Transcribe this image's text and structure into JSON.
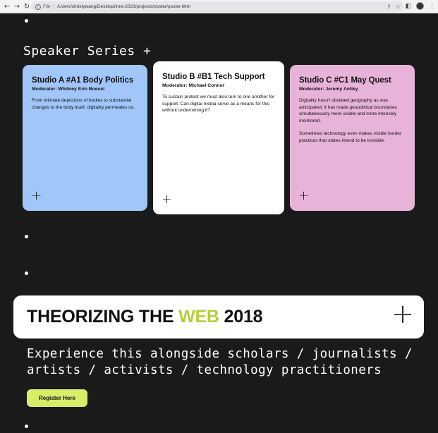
{
  "browser": {
    "back": "←",
    "forward": "→",
    "reload": "↻",
    "scheme": "File",
    "sep": "|",
    "url": "/Users/christywang/Desktop/imw-2023/projects/poster/poster.html",
    "share": "⇪",
    "star": "☆",
    "sidepanel": "◧",
    "menu": "⋮"
  },
  "series": {
    "title": "Speaker Series +"
  },
  "cards": [
    {
      "title": "Studio A #A1 Body Politics",
      "moderator": "Moderator: Whitney Erin Boesel",
      "paragraphs": [
        "From intimate depictions of bodies to substantial changes to the body itself, digitality permeates us."
      ],
      "plus": "+",
      "color": "#a0c6fa"
    },
    {
      "title": "Studio B #B1 Tech Support",
      "moderator": "Moderator: Michael Connor",
      "paragraphs": [
        "To sustain protest we must also turn to one another for support. Can digital media serve as a means for this without undermining it?"
      ],
      "plus": "+",
      "color": "#ffffff"
    },
    {
      "title": "Studio C #C1 May Quest",
      "moderator": "Moderator: Jeremy Antley",
      "paragraphs": [
        "Digitality hasn't obviated geography as was anticipated; it has made geopolitical boundaries simultaneously more visible and more intensely monitored.",
        "Sometimes technology even makes visible border practices that states intend to be invisible."
      ],
      "plus": "+",
      "color": "#e8b3d8"
    }
  ],
  "banner": {
    "title_pre": "THEORIZING THE ",
    "title_highlight": "WEB",
    "title_post": " 2018",
    "plus": "+",
    "highlight_color": "#b6cf3a"
  },
  "tagline": "Experience this alongside scholars / journalists / artists / activists / technology practitioners",
  "register": {
    "label": "Register Here",
    "color": "#d8ee6a"
  }
}
